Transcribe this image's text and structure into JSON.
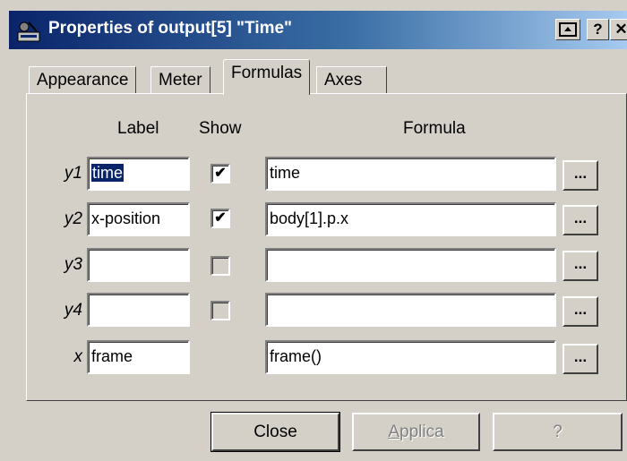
{
  "window": {
    "title": "Properties of output[5] \"Time\"",
    "ctx_icon": "context-help-box",
    "help_label": "?",
    "close_label": "✕"
  },
  "tabs": [
    {
      "label": "Appearance",
      "active": false
    },
    {
      "label": "Meter",
      "active": false
    },
    {
      "label": "Formulas",
      "active": true
    },
    {
      "label": "Axes",
      "active": false
    }
  ],
  "headers": {
    "label": "Label",
    "show": "Show",
    "formula": "Formula"
  },
  "rows": [
    {
      "name": "y1",
      "label": "time",
      "show": true,
      "formula": "time",
      "label_selected": true
    },
    {
      "name": "y2",
      "label": "x-position",
      "show": true,
      "formula": "body[1].p.x"
    },
    {
      "name": "y3",
      "label": "",
      "show": false,
      "formula": ""
    },
    {
      "name": "y4",
      "label": "",
      "show": false,
      "formula": ""
    },
    {
      "name": "x",
      "label": "frame",
      "formula": "frame()"
    }
  ],
  "ellipsis": "...",
  "check_mark": "✔",
  "buttons": {
    "close": "Close",
    "apply_prefix": "A",
    "apply_rest": "pplica",
    "help": "?"
  }
}
